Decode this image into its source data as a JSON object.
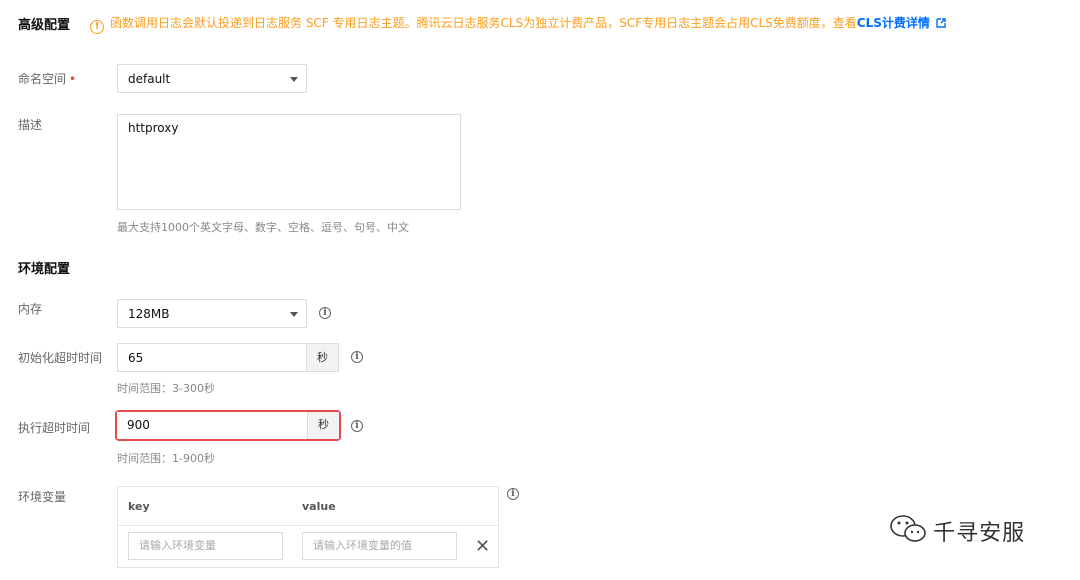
{
  "advanced": {
    "title": "高级配置",
    "notice_text": "函数调用日志会默认投递到日志服务 SCF 专用日志主题。腾讯云日志服务CLS为独立计费产品，SCF专用日志主题会占用CLS免费额度，查看",
    "notice_link": "CLS计费详情",
    "colors": {
      "warning": "#ff9c19",
      "link": "#006eff"
    }
  },
  "namespace": {
    "label": "命名空间",
    "required_mark": "•",
    "value": "default"
  },
  "description": {
    "label": "描述",
    "value": "httproxy",
    "hint": "最大支持1000个英文字母、数字、空格、逗号、句号、中文"
  },
  "env_config": {
    "title": "环境配置"
  },
  "memory": {
    "label": "内存",
    "value": "128MB"
  },
  "init_timeout": {
    "label": "初始化超时时间",
    "value": "65",
    "unit": "秒",
    "hint": "时间范围：3-300秒"
  },
  "exec_timeout": {
    "label": "执行超时时间",
    "value": "900",
    "unit": "秒",
    "hint": "时间范围：1-900秒",
    "highlight_color": "#e24b4b"
  },
  "env_vars": {
    "label": "环境变量",
    "columns": [
      "key",
      "value"
    ],
    "key_placeholder": "请输入环境变量",
    "value_placeholder": "请输入环境变量的值",
    "remove_glyph": "✕"
  },
  "watermark": {
    "text": "千寻安服"
  },
  "icons": {
    "notice": "warning-circle-icon",
    "external": "external-link-icon",
    "info": "info-circle-icon",
    "dropdown": "chevron-down-icon",
    "remove": "close-icon",
    "watermark": "wechat-icon"
  }
}
